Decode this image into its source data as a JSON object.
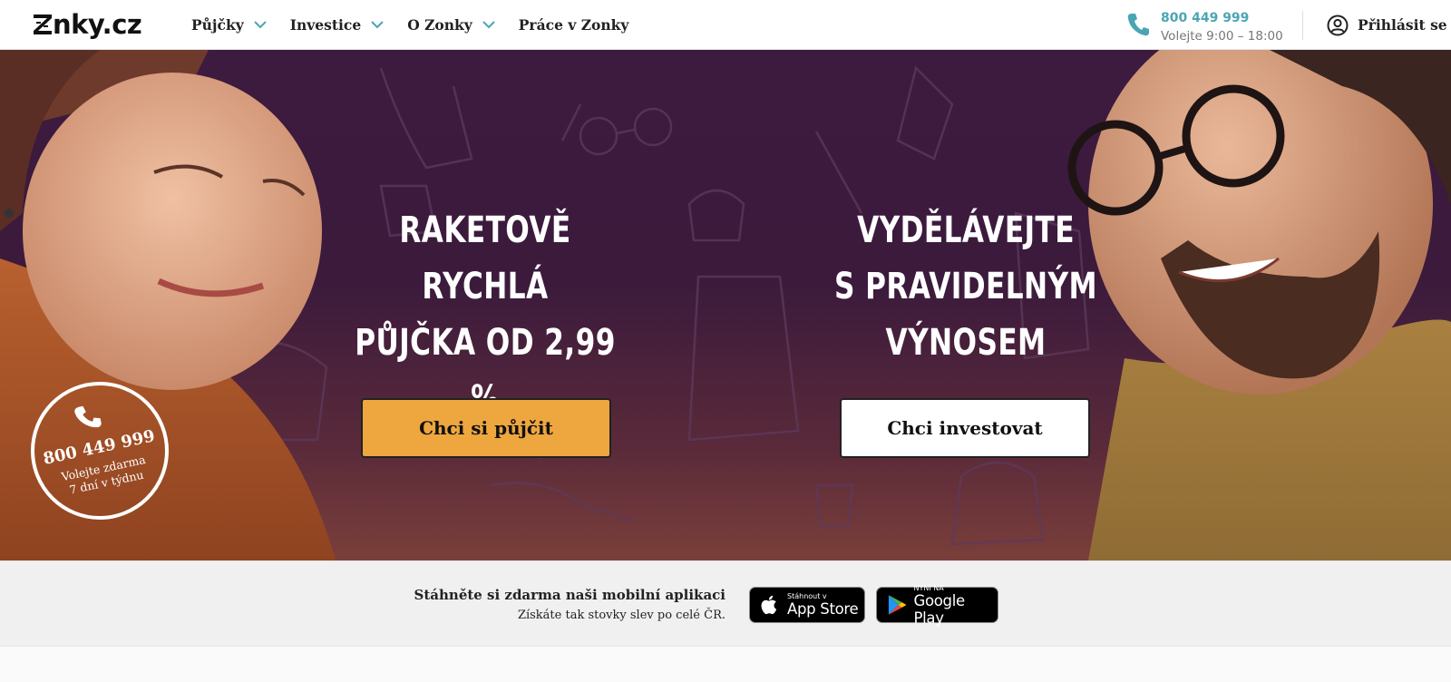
{
  "header": {
    "logo_text": "nky.cz",
    "nav": [
      {
        "label": "Půjčky",
        "has_dropdown": true
      },
      {
        "label": "Investice",
        "has_dropdown": true
      },
      {
        "label": "O Zonky",
        "has_dropdown": true
      },
      {
        "label": "Práce v Zonky",
        "has_dropdown": false
      }
    ],
    "phone": {
      "number": "800 449 999",
      "hours": "Volejte 9:00 – 18:00",
      "icon": "phone-icon"
    },
    "login_label": "Přihlásit se",
    "accent_color": "#4aa5b3"
  },
  "hero": {
    "left": {
      "line1": "RAKETOVĚ RYCHLÁ",
      "line2": "PŮJČKA OD 2,99 %",
      "cta_label": "Chci si půjčit",
      "cta_color": "#eea63f"
    },
    "right": {
      "line1": "VYDĚLÁVEJTE",
      "line2": "S PRAVIDELNÝM VÝNOSEM",
      "cta_label": "Chci investovat"
    },
    "badge": {
      "number": "800 449 999",
      "line1": "Volejte zdarma",
      "line2": "7 dní v týdnu"
    }
  },
  "app_strip": {
    "title": "Stáhněte si zdarma naši mobilní aplikaci",
    "subtitle": "Získáte tak stovky slev po celé ČR.",
    "app_store": {
      "small": "Stáhnout v",
      "big": "App Store"
    },
    "google_play": {
      "small": "NYNÍ NA",
      "big": "Google Play"
    }
  }
}
